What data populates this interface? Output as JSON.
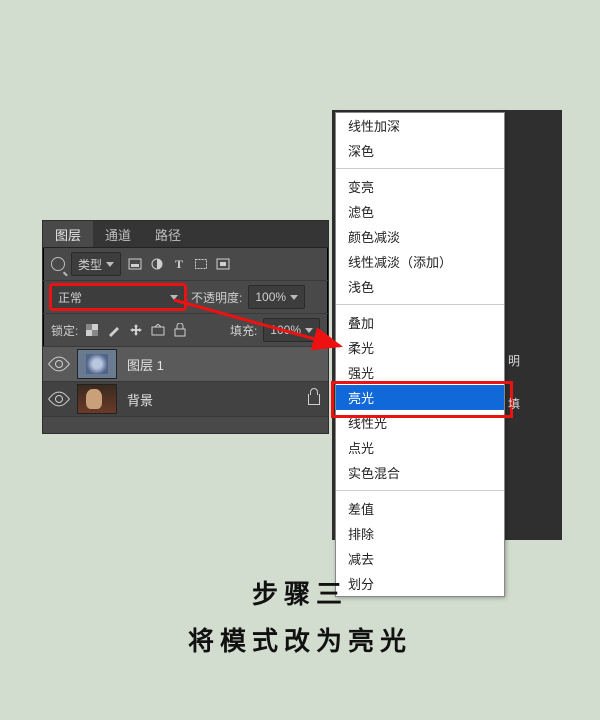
{
  "layers_panel": {
    "tabs": [
      "图层",
      "通道",
      "路径"
    ],
    "filter_label": "类型",
    "blend_mode": "正常",
    "opacity_label": "不透明度:",
    "opacity_value": "100%",
    "lock_label": "锁定:",
    "fill_label": "填充:",
    "fill_value": "100%",
    "layers": [
      {
        "name": "图层 1",
        "selected": true,
        "thumb": "flower"
      },
      {
        "name": "背景",
        "selected": false,
        "thumb": "portrait",
        "locked": true
      }
    ]
  },
  "blend_menu": {
    "groups": [
      [
        "线性加深",
        "深色"
      ],
      [
        "变亮",
        "滤色",
        "颜色减淡",
        "线性减淡（添加）",
        "浅色"
      ],
      [
        "叠加",
        "柔光",
        "强光",
        "亮光",
        "线性光",
        "点光",
        "实色混合"
      ],
      [
        "差值",
        "排除",
        "减去",
        "划分"
      ]
    ],
    "selected": "亮光"
  },
  "side_labels": {
    "opacity_hint": "明",
    "fill_hint": "填"
  },
  "caption": {
    "line1": "步骤三",
    "line2": "将模式改为亮光"
  }
}
